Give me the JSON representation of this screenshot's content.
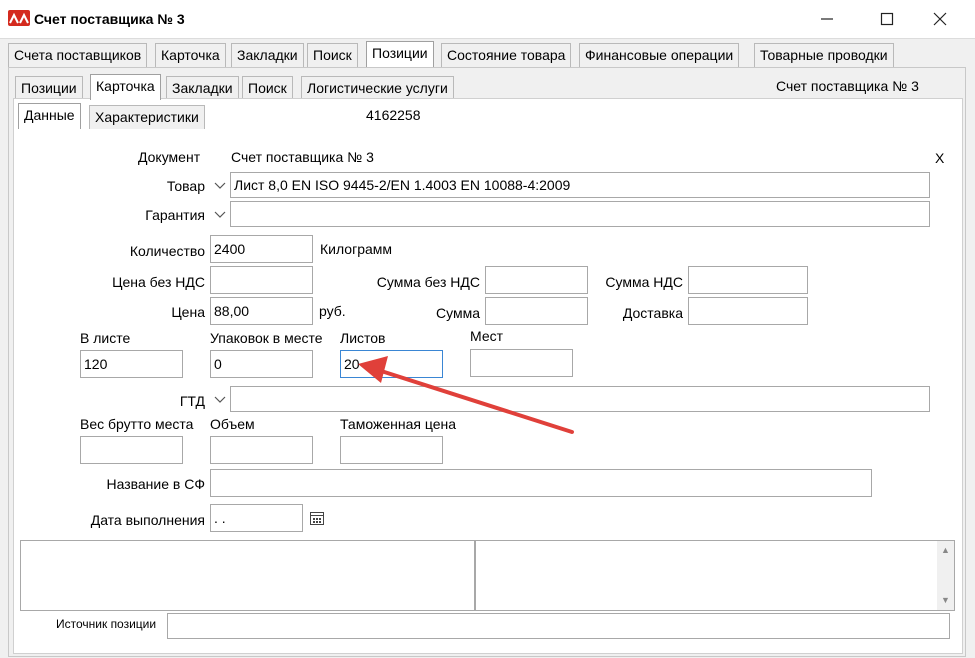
{
  "window": {
    "title": "Счет поставщика № 3"
  },
  "tabs_top": [
    "Счета поставщиков",
    "Карточка",
    "Закладки",
    "Поиск",
    "Позиции",
    "Состояние товара",
    "Финансовые операции",
    "Товарные проводки"
  ],
  "tabs_second": [
    "Позиции",
    "Карточка",
    "Закладки",
    "Поиск",
    "Логистические услуги"
  ],
  "tabs_third": [
    "Данные",
    "Характеристики"
  ],
  "header": {
    "doc_caption": "Счет поставщика № 3",
    "id_number": "4162258"
  },
  "form": {
    "document_label": "Документ",
    "document_value": "Счет поставщика № 3",
    "close_mark": "X",
    "goods_label": "Товар",
    "goods_value": "Лист 8,0 EN ISO 9445-2/EN 1.4003 EN 10088-4:2009",
    "guarantee_label": "Гарантия",
    "guarantee_value": "",
    "quantity_label": "Количество",
    "quantity_value": "2400",
    "quantity_unit": "Килограмм",
    "price_novat_label": "Цена без НДС",
    "price_novat_value": "",
    "sum_novat_label": "Сумма без НДС",
    "sum_novat_value": "",
    "vat_sum_label": "Сумма НДС",
    "vat_sum_value": "",
    "price_label": "Цена",
    "price_value": "88,00",
    "price_unit": "руб.",
    "sum_label": "Сумма",
    "sum_value": "",
    "delivery_label": "Доставка",
    "delivery_value": "",
    "in_sheet_label": "В листе",
    "in_sheet_value": "120",
    "packs_label": "Упаковок в месте",
    "packs_value": "0",
    "sheets_label": "Листов",
    "sheets_value": "20",
    "places_label": "Мест",
    "places_value": "",
    "gtd_label": "ГТД",
    "gtd_value": "",
    "gross_label": "Вес брутто места",
    "gross_value": "",
    "volume_label": "Объем",
    "volume_value": "",
    "customs_label": "Таможенная цена",
    "customs_value": "",
    "invoice_name_label": "Название в СФ",
    "invoice_name_value": "",
    "date_label": "Дата выполнения",
    "date_value": " .  .",
    "source_label": "Источник позиции",
    "source_value": ""
  },
  "colors": {
    "accent": "#3a86d4",
    "arrow": "#e0403a",
    "app_icon": "#d42a1e"
  },
  "icons": [
    "app-logo-icon",
    "minimize-icon",
    "maximize-icon",
    "close-icon",
    "chevron-down-icon",
    "calendar-icon",
    "scroll-up-icon",
    "scroll-down-icon"
  ]
}
